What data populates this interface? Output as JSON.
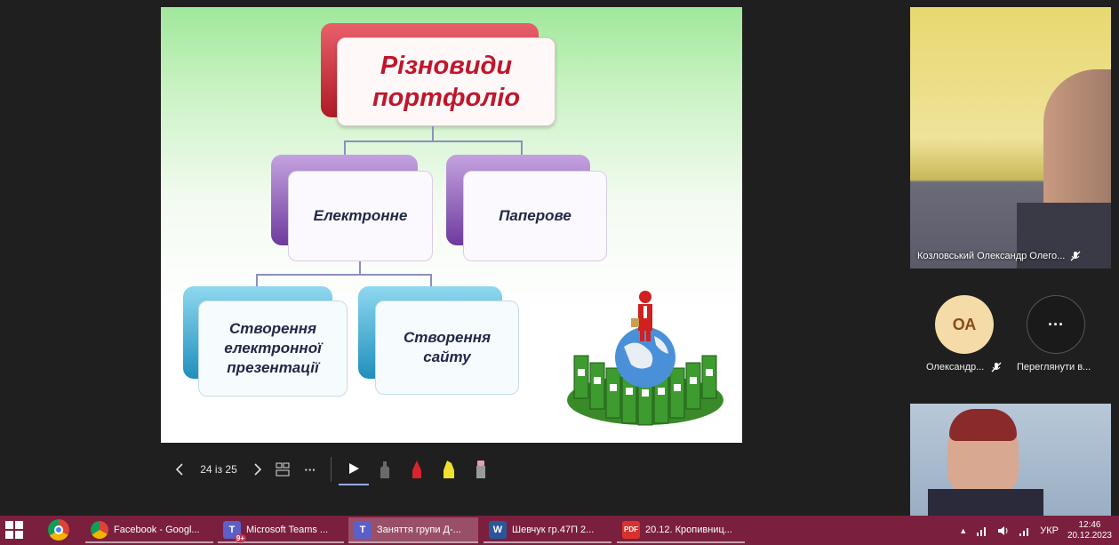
{
  "slide": {
    "title": "Різновиди портфоліо",
    "node_electronic": "Електронне",
    "node_paper": "Паперове",
    "node_presentation": "Створення електронної презентації",
    "node_site": "Створення сайту"
  },
  "toolbar": {
    "prev_icon": "chevron-left-icon",
    "page_indicator": "24 із 25",
    "next_icon": "chevron-right-icon",
    "grid_icon": "slides-grid-icon",
    "more_label": "···",
    "tools": [
      "pointer-icon",
      "pen-gray-icon",
      "pen-red-icon",
      "highlighter-yellow-icon",
      "eraser-icon"
    ]
  },
  "participants": {
    "main_name": "Козловський Олександр Олего...",
    "avatar_initials": "ОА",
    "avatar_name": "Олександр...",
    "more_label": "···",
    "more_name": "Переглянути в..."
  },
  "taskbar": {
    "items": [
      {
        "label": "Facebook - Googl...",
        "icon": "chrome-icon"
      },
      {
        "label": "Microsoft Teams ...",
        "icon": "teams-icon",
        "badge": "9+"
      },
      {
        "label": "Заняття групи Д-...",
        "icon": "teams-icon"
      },
      {
        "label": "Шевчук гр.47П 2...",
        "icon": "word-icon"
      },
      {
        "label": "20.12. Кропивниц...",
        "icon": "pdf-icon"
      }
    ],
    "language": "УКР",
    "time": "12:46",
    "date": "20.12.2023"
  },
  "colors": {
    "taskbar": "#7a1f3d",
    "title_red": "#c0162c",
    "purple": "#8a5ab8",
    "blue": "#2a9fc9"
  }
}
